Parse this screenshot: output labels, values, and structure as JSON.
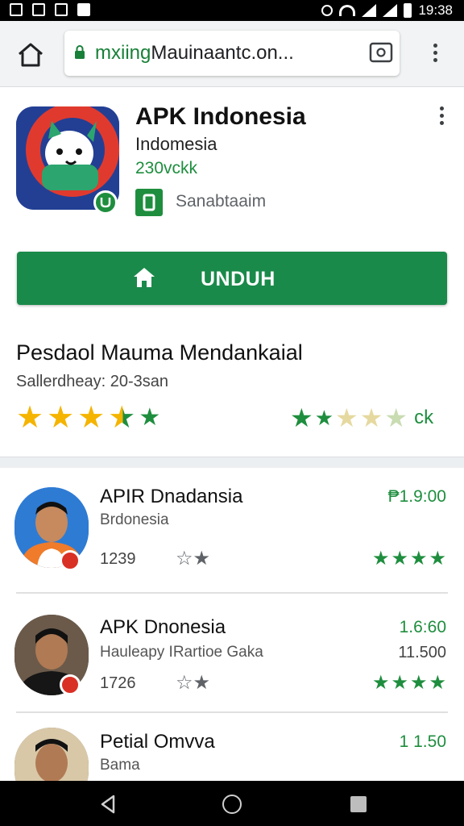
{
  "status_bar": {
    "time": "19:38"
  },
  "browser": {
    "url_scheme": "mxiing",
    "url_rest": "Mauinaantc.on...",
    "icons": {
      "home": "home-icon",
      "lock": "lock-icon",
      "tabs": "tabs-icon",
      "menu": "more-vert-icon"
    }
  },
  "app": {
    "title": "APK Indonesia",
    "subtitle": "Indomesia",
    "size": "230vckk",
    "badge_label": "Sanabtaaim",
    "install_label": "UNDUH",
    "colors": {
      "accent": "#1a8a4a",
      "star_yellow": "#f4b400",
      "star_green": "#1e8e3e"
    }
  },
  "rating": {
    "title": "Pesdaol Mauma Mendankaial",
    "subtitle": "Sallerdheay: 20-3san",
    "left_stars": 3.5,
    "unit": "ck"
  },
  "list": [
    {
      "title": "APIR Dnadansia",
      "subtitle": "Brdonesia",
      "count": "1239",
      "price": "₱1.9:00",
      "stars": "★★★★"
    },
    {
      "title": "APK Dnonesia",
      "subtitle": "Hauleapy IRartioe Gaka",
      "count": "1726",
      "price": "1.6:60",
      "price2": "11.500",
      "stars": "★★★★"
    },
    {
      "title": "Petial Omvva",
      "subtitle": "Bama",
      "price": "1 1.50"
    }
  ],
  "navbar": {
    "back": "back-icon",
    "home": "home-circle-icon",
    "recent": "recent-apps-icon"
  }
}
